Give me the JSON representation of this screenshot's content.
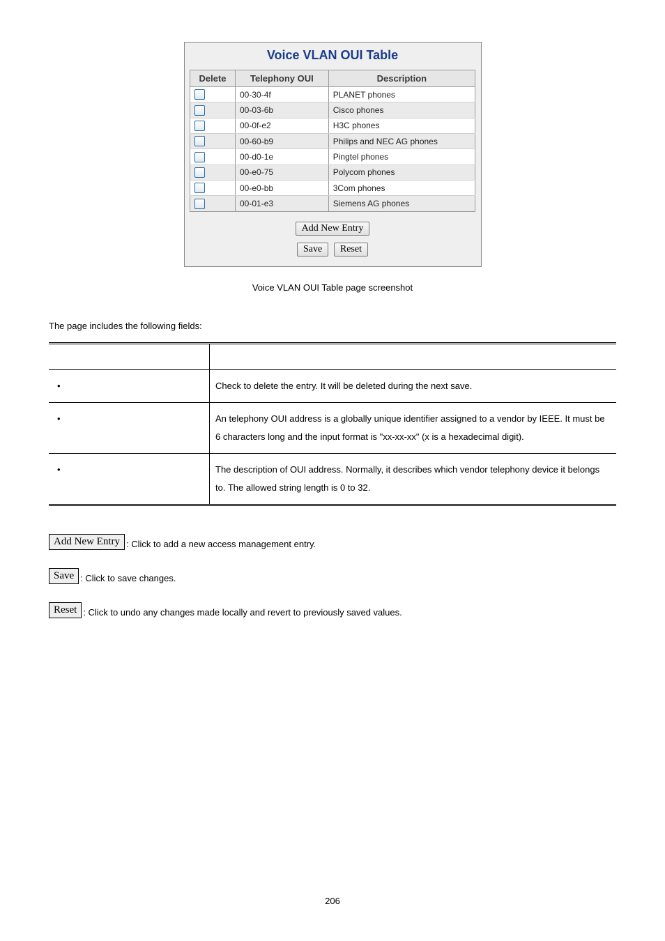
{
  "screenshot": {
    "title": "Voice VLAN OUI Table",
    "headers": {
      "delete": "Delete",
      "oui": "Telephony OUI",
      "desc": "Description"
    },
    "rows": [
      {
        "oui": "00-30-4f",
        "desc": "PLANET phones"
      },
      {
        "oui": "00-03-6b",
        "desc": "Cisco phones"
      },
      {
        "oui": "00-0f-e2",
        "desc": "H3C phones"
      },
      {
        "oui": "00-60-b9",
        "desc": "Philips and NEC AG phones"
      },
      {
        "oui": "00-d0-1e",
        "desc": "Pingtel phones"
      },
      {
        "oui": "00-e0-75",
        "desc": "Polycom phones"
      },
      {
        "oui": "00-e0-bb",
        "desc": "3Com phones"
      },
      {
        "oui": "00-01-e3",
        "desc": "Siemens AG phones"
      }
    ],
    "buttons": {
      "add": "Add New Entry",
      "save": "Save",
      "reset": "Reset"
    }
  },
  "caption": "Voice VLAN OUI Table page screenshot",
  "intro": "The page includes the following fields:",
  "fields": [
    {
      "desc": "Check to delete the entry. It will be deleted during the next save."
    },
    {
      "desc": "An telephony OUI address is a globally unique identifier assigned to a vendor by IEEE. It must be 6 characters long and the input format is \"xx-xx-xx\" (x is a hexadecimal digit)."
    },
    {
      "desc": "The description of OUI address. Normally, it describes which vendor telephony device it belongs to. The allowed string length is 0 to 32."
    }
  ],
  "buttons_help": {
    "add": {
      "label": "Add New Entry",
      "text": ": Click to add a new access management entry."
    },
    "save": {
      "label": "Save",
      "text": ": Click to save changes."
    },
    "reset": {
      "label": "Reset",
      "text": ": Click to undo any changes made locally and revert to previously saved values."
    }
  },
  "page_number": "206"
}
